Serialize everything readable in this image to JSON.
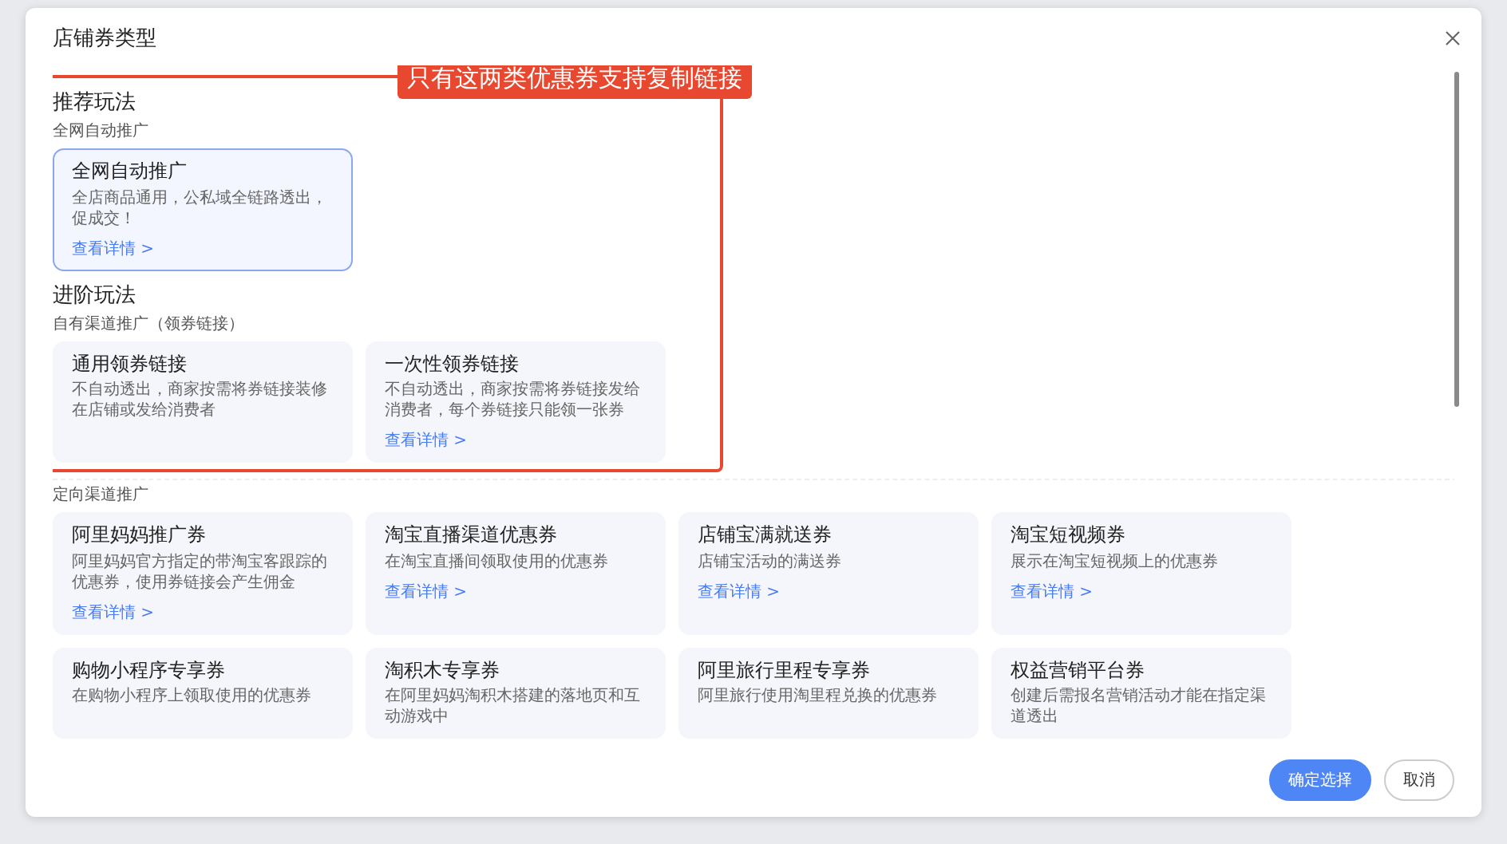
{
  "dialog": {
    "title": "店铺券类型"
  },
  "annotation": "只有这两类优惠券支持复制链接",
  "highlighted_sections": [
    {
      "heading": "推荐玩法",
      "label": "全网自动推广",
      "cards": [
        {
          "title": "全网自动推广",
          "description": "全店商品通用，公私域全链路透出，促成交！",
          "link": "查看详情 >",
          "selected": true
        }
      ]
    },
    {
      "heading": "进阶玩法",
      "label": "自有渠道推广（领券链接）",
      "cards": [
        {
          "title": "通用领券链接",
          "description": "不自动透出，商家按需将券链接装修在店铺或发给消费者",
          "selected": false
        },
        {
          "title": "一次性领券链接",
          "description": "不自动透出，商家按需将券链接发给消费者，每个券链接只能领一张券",
          "link": "查看详情 >",
          "selected": false
        }
      ]
    }
  ],
  "other_sections": [
    {
      "label": "定向渠道推广",
      "cards": [
        {
          "title": "阿里妈妈推广券",
          "description": "阿里妈妈官方指定的带淘宝客跟踪的优惠券，使用券链接会产生佣金",
          "link": "查看详情 >",
          "selected": false
        },
        {
          "title": "淘宝直播渠道优惠券",
          "description": "在淘宝直播间领取使用的优惠券",
          "link": "查看详情 >",
          "selected": false
        },
        {
          "title": "店铺宝满就送券",
          "description": "店铺宝活动的满送券",
          "link": "查看详情 >",
          "selected": false
        },
        {
          "title": "淘宝短视频券",
          "description": "展示在淘宝短视频上的优惠券",
          "link": "查看详情 >",
          "selected": false
        },
        {
          "title": "购物小程序专享券",
          "description": "在购物小程序上领取使用的优惠券",
          "selected": false
        },
        {
          "title": "淘积木专享券",
          "description": "在阿里妈妈淘积木搭建的落地页和互动游戏中",
          "selected": false
        },
        {
          "title": "阿里旅行里程专享券",
          "description": "阿里旅行使用淘里程兑换的优惠券",
          "selected": false
        },
        {
          "title": "权益营销平台券",
          "description": "创建后需报名营销活动才能在指定渠道透出",
          "selected": false
        }
      ]
    }
  ],
  "buttons": [
    {
      "label": "确定选择",
      "kind": "primary"
    },
    {
      "label": "取消",
      "kind": "secondary"
    }
  ]
}
